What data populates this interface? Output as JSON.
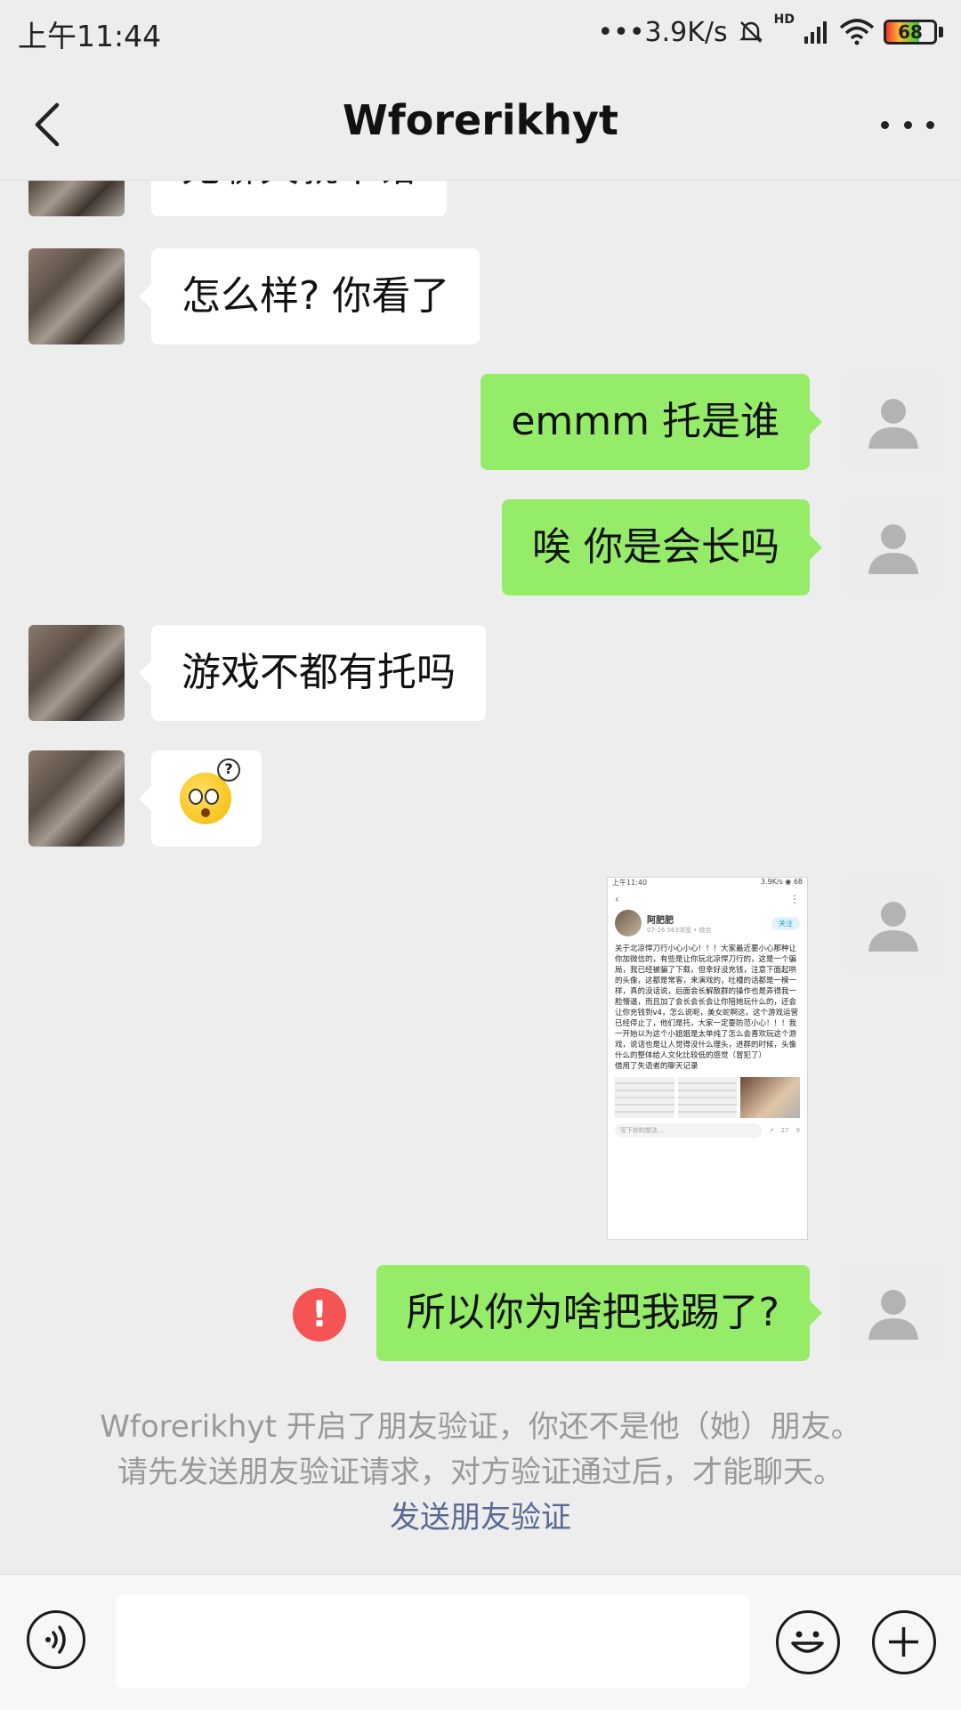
{
  "status_bar": {
    "time": "上午11:44",
    "network_speed": "•••3.9K/s",
    "network_type": "HD",
    "battery_level": "68",
    "icons": [
      "dots-icon",
      "mute-bell-icon",
      "signal-icon",
      "wifi-icon",
      "battery-icon"
    ]
  },
  "nav": {
    "title": "Wforerikhyt",
    "back_icon": "chevron-left-icon",
    "more_icon": "more-dots-icon"
  },
  "messages": [
    {
      "from": "peer",
      "text": "无聊天就不错"
    },
    {
      "from": "peer",
      "text": "怎么样? 你看了"
    },
    {
      "from": "me",
      "text": "emmm  托是谁"
    },
    {
      "from": "me",
      "text": "唉  你是会长吗"
    },
    {
      "from": "peer",
      "text": "游戏不都有托吗"
    },
    {
      "from": "peer",
      "sticker": "thinking-face-emoji"
    },
    {
      "from": "me",
      "image": "forum-post-screenshot"
    },
    {
      "from": "me",
      "text": "所以你为啥把我踢了?",
      "failed": true
    }
  ],
  "thumbnail": {
    "status_time": "上午11:40",
    "status_right": "3.9K/s ◉ 68",
    "author": "阿肥肥",
    "meta": "07-26 563浏览 • 综合",
    "follow": "关注",
    "body": "关于北凉悍刀行小心小心！！！大家最近要小心那种让你加微信的，有些是让你玩北凉悍刀行的，这是一个骗局，我已经被骗了下载，但幸好没充钱，注意下面起哄的头像，这都是常客，来演戏的，吐槽的话都是一模一样，真的没话说，后面会长解散群的操作也是弄得我一脸懵逼，而且加了会长会长会让你陪她玩什么的，还会让你充钱到v4，怎么说呢，美女蛇啊这，这个游戏运营已经停止了，他们是托，大家一定要防范小心！！！我一开始以为这个小姐姐是太单纯了怎么会喜欢玩这个游戏，说话也是让人觉得没什么理头，进群的时候，头像什么的整体给人文化比较低的感觉（冒犯了）",
    "caption": "借用了失语者的聊天记录",
    "input_placeholder": "写下你的想法...",
    "comment_count": "27",
    "like_count": "9"
  },
  "notice": {
    "line1": "Wforerikhyt 开启了朋友验证，你还不是他（她）朋友。",
    "line2": "请先发送朋友验证请求，对方验证通过后，才能聊天。",
    "link": "发送朋友验证"
  },
  "input_bar": {
    "text_value": "",
    "voice_icon": "voice-icon",
    "emoji_icon": "emoji-icon",
    "plus_icon": "plus-icon"
  },
  "colors": {
    "background": "#ededed",
    "my_bubble": "#95ec69",
    "peer_bubble": "#ffffff",
    "fail_red": "#f45454",
    "link_blue": "#576b95"
  }
}
